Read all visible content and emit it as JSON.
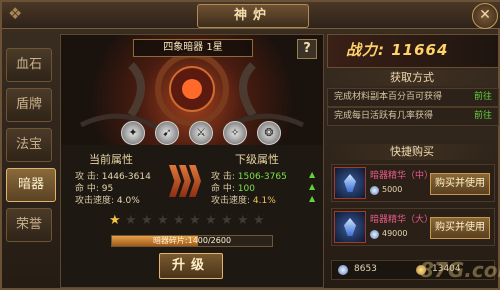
{
  "window": {
    "title": "神炉"
  },
  "sidebar": {
    "items": [
      {
        "label": "血石"
      },
      {
        "label": "盾牌"
      },
      {
        "label": "法宝"
      },
      {
        "label": "暗器",
        "active": true
      },
      {
        "label": "荣誉"
      }
    ]
  },
  "artifact": {
    "name": "四象暗器 1星",
    "help": "?"
  },
  "stats": {
    "current_title": "当前属性",
    "next_title": "下级属性",
    "current": [
      {
        "label": "攻   击:",
        "value": "1446-3614"
      },
      {
        "label": "命   中:",
        "value": "95"
      },
      {
        "label": "攻击速度:",
        "value": "4.0%"
      }
    ],
    "next": [
      {
        "label": "攻   击:",
        "value": "1506-3765"
      },
      {
        "label": "命   中:",
        "value": "100"
      },
      {
        "label": "攻击速度:",
        "value": "4.1%"
      }
    ]
  },
  "stars": {
    "filled": 1,
    "total": 10
  },
  "progress": {
    "label": "暗器碎片:1400/2600",
    "fraction": 0.538
  },
  "upgrade_label": "升级",
  "power": {
    "label": "战力: 11664"
  },
  "obtain": {
    "title": "获取方式",
    "rows": [
      {
        "text": "完成材料副本百分百可获得",
        "action": "前往"
      },
      {
        "text": "完成每日活跃有几率获得",
        "action": "前往"
      }
    ]
  },
  "shop": {
    "title": "快捷购买",
    "items": [
      {
        "name": "暗器精华（中）",
        "price": "5000",
        "button": "购买并使用"
      },
      {
        "name": "暗器精华（大）",
        "price": "49000",
        "button": "购买并使用"
      }
    ]
  },
  "currency": {
    "diamonds": "8653",
    "gold": "13404"
  },
  "watermark": "87G.com",
  "colors": {
    "accent_gold": "#ffd26a",
    "go_green": "#5fd53a",
    "item_pink": "#e85a8a"
  }
}
